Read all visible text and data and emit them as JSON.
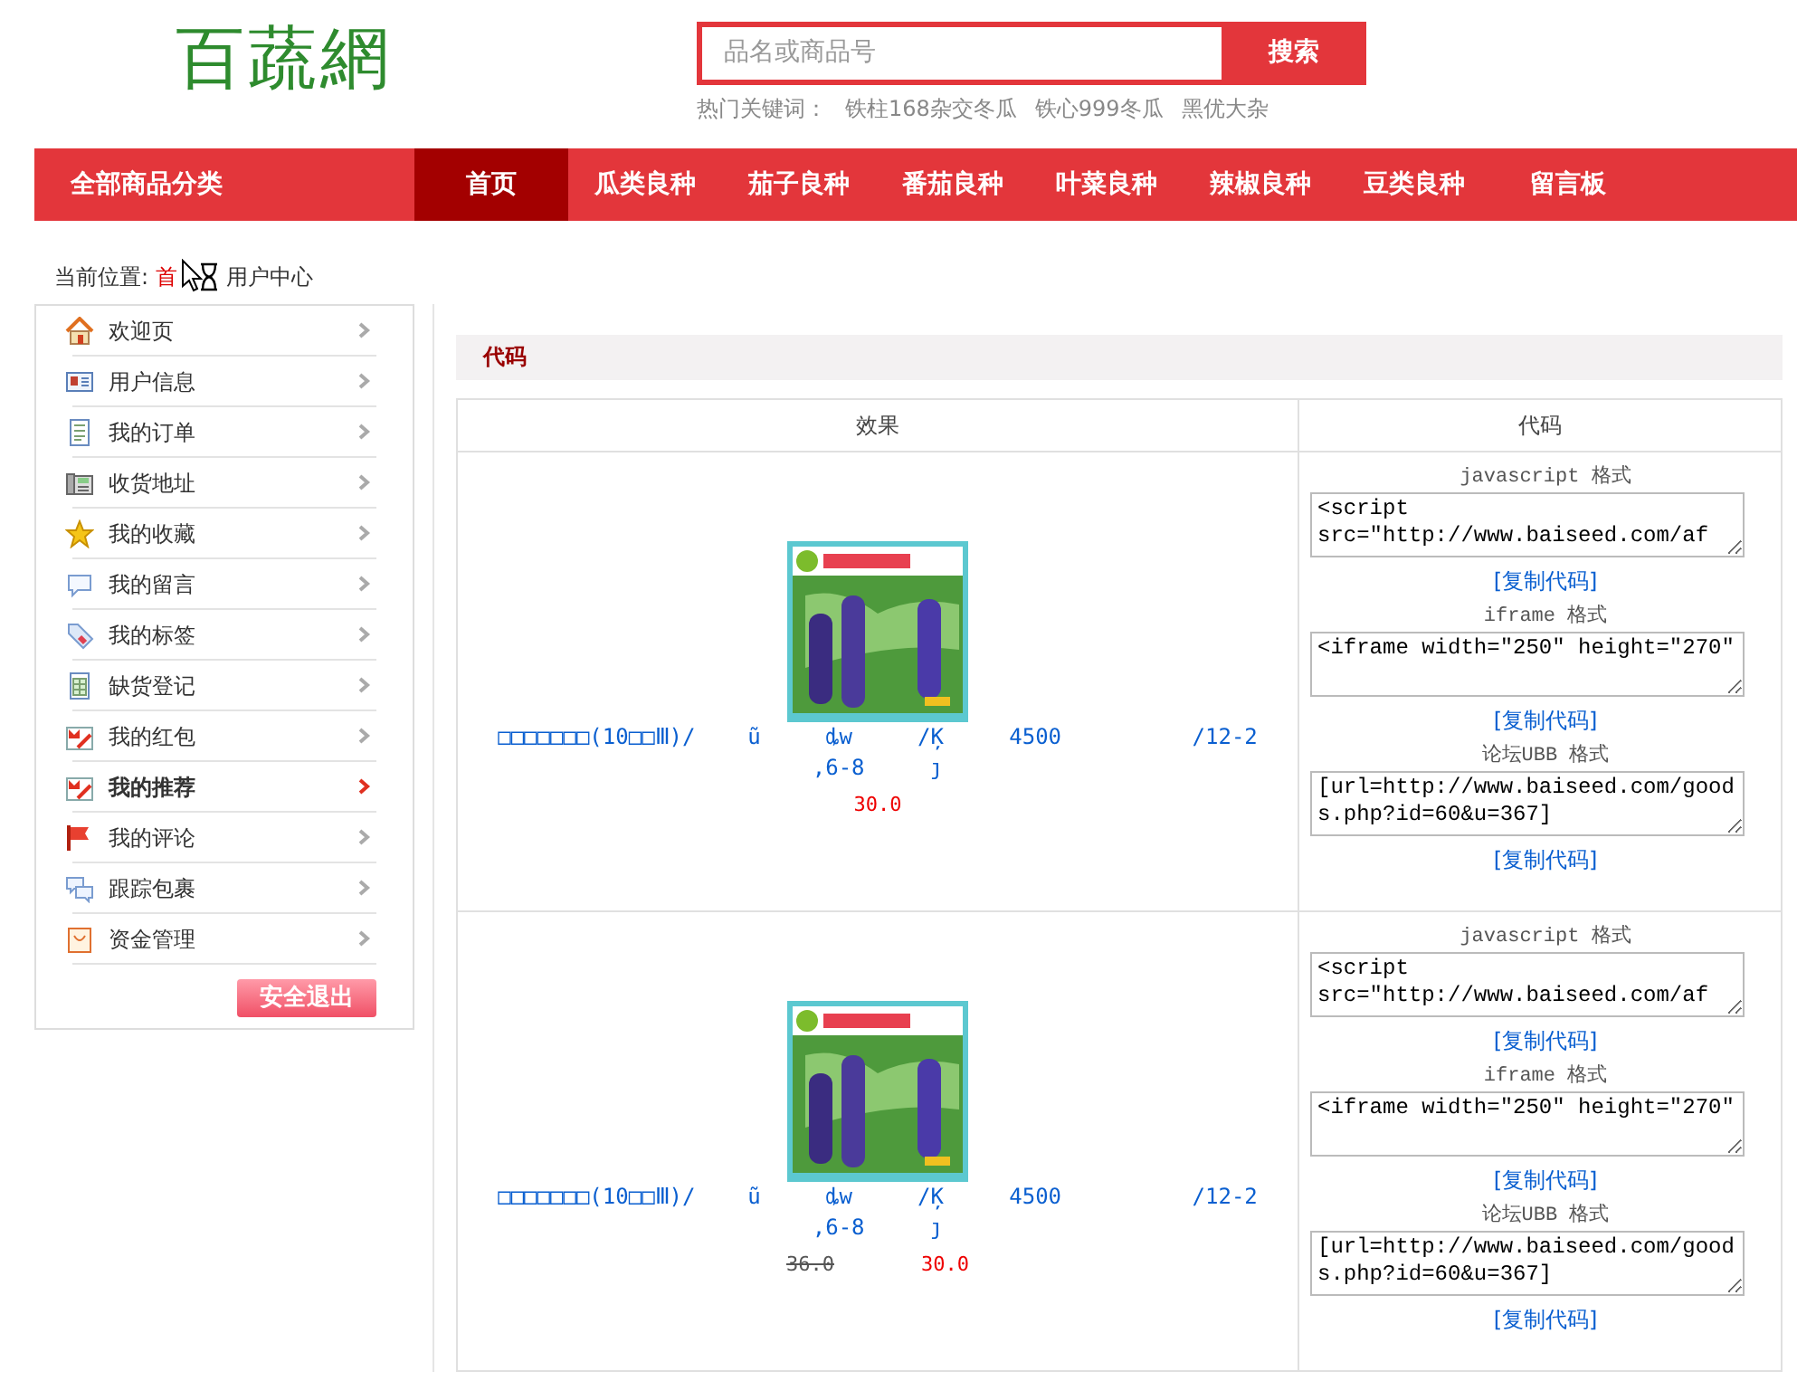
{
  "logo": "百蔬網",
  "search": {
    "placeholder": "品名或商品号",
    "button": "搜索"
  },
  "hot_keywords": {
    "label": "热门关键词：",
    "items": [
      "铁柱168杂交冬瓜",
      "铁心999冬瓜",
      "黑优大杂"
    ]
  },
  "category_menu": "全部商品分类",
  "nav": [
    {
      "label": "首页",
      "selected": true
    },
    {
      "label": "瓜类良种",
      "selected": false
    },
    {
      "label": "茄子良种",
      "selected": false
    },
    {
      "label": "番茄良种",
      "selected": false
    },
    {
      "label": "叶菜良种",
      "selected": false
    },
    {
      "label": "辣椒良种",
      "selected": false
    },
    {
      "label": "豆类良种",
      "selected": false
    },
    {
      "label": "留言板",
      "selected": false
    }
  ],
  "breadcrumb": {
    "label": "当前位置:",
    "home": "首",
    "current": "用户中心"
  },
  "sidebar": {
    "items": [
      {
        "label": "欢迎页",
        "selected": false
      },
      {
        "label": "用户信息",
        "selected": false
      },
      {
        "label": "我的订单",
        "selected": false
      },
      {
        "label": "收货地址",
        "selected": false
      },
      {
        "label": "我的收藏",
        "selected": false
      },
      {
        "label": "我的留言",
        "selected": false
      },
      {
        "label": "我的标签",
        "selected": false
      },
      {
        "label": "缺货登记",
        "selected": false
      },
      {
        "label": "我的红包",
        "selected": false
      },
      {
        "label": "我的推荐",
        "selected": true
      },
      {
        "label": "我的评论",
        "selected": false
      },
      {
        "label": "跟踪包裹",
        "selected": false
      },
      {
        "label": "资金管理",
        "selected": false
      }
    ],
    "logout": "安全退出"
  },
  "section_title": "代码",
  "table": {
    "columns": [
      "效果",
      "代码"
    ],
    "rows": [
      {
        "product": {
          "kind": "picture",
          "name": "□□□□□□□(10□□Ⅲ)/    ũ     ȡw     /Ķ     4500          /12-2     ,6-8     ȷ",
          "price": "30.0"
        },
        "codes": [
          {
            "format": "javascript 格式",
            "code": "<script src=\"http://www.baiseed.com/af",
            "copy": "[复制代码]"
          },
          {
            "format": "iframe 格式",
            "code": "<iframe width=\"250\" height=\"270\"",
            "copy": "[复制代码]"
          },
          {
            "format": "论坛UBB 格式",
            "code": "[url=http://www.baiseed.com/goods.php?id=60&u=367]",
            "copy": "[复制代码]"
          }
        ]
      },
      {
        "product": {
          "kind": "picture",
          "name": "□□□□□□□(10□□Ⅲ)/    ũ     ȡw     /Ķ     4500          /12-2     ,6-8     ȷ",
          "old_price": "36.0",
          "price": "30.0"
        },
        "codes": [
          {
            "format": "javascript 格式",
            "code": "<script src=\"http://www.baiseed.com/af",
            "copy": "[复制代码]"
          },
          {
            "format": "iframe 格式",
            "code": "<iframe width=\"250\" height=\"270\"",
            "copy": "[复制代码]"
          },
          {
            "format": "论坛UBB 格式",
            "code": "[url=http://www.baiseed.com/goods.php?id=60&u=367]",
            "copy": "[复制代码]"
          }
        ]
      }
    ]
  }
}
